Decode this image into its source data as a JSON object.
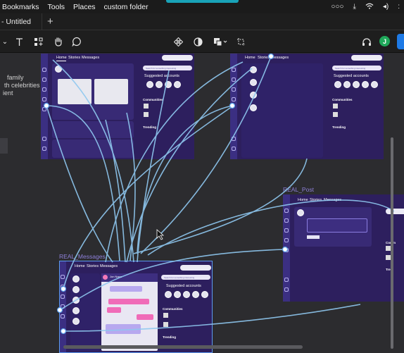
{
  "menubar": {
    "items": [
      "Bookmarks",
      "Tools",
      "Places",
      "custom folder"
    ]
  },
  "tabs": {
    "active_label": "- Untitled",
    "add_label": "+"
  },
  "toolbar": {
    "user_initial": "J"
  },
  "left_panel": {
    "lines": [
      "family",
      "th celebrities",
      "ient"
    ]
  },
  "frames": {
    "home_top_left": {
      "nav": [
        "Home",
        "Stories",
        "Messages"
      ],
      "search_placeholder": "Search for something interesting",
      "suggested_title": "Suggested accounts",
      "communities_title": "Communities",
      "trending_title": "Trending"
    },
    "home_top_right": {
      "nav": [
        "Home",
        "Stories",
        "Messages"
      ],
      "search_placeholder": "Search for something interesting",
      "suggested_title": "Suggested accounts",
      "communities_title": "Communities",
      "trending_title": "Trending"
    },
    "real_post": {
      "label": "REAL_Post",
      "nav": [
        "Home",
        "Stories",
        "Messages"
      ],
      "communities_title": "Comm",
      "trending_title": "Tren"
    },
    "real_messages": {
      "label": "REAL_Messages",
      "nav": [
        "Home",
        "Stories",
        "Messages"
      ],
      "search_placeholder": "Search for something interesting",
      "suggested_title": "Suggested accounts",
      "communities_title": "Communities",
      "trending_title": "Trending",
      "chat_user": "Jon Nana"
    }
  }
}
